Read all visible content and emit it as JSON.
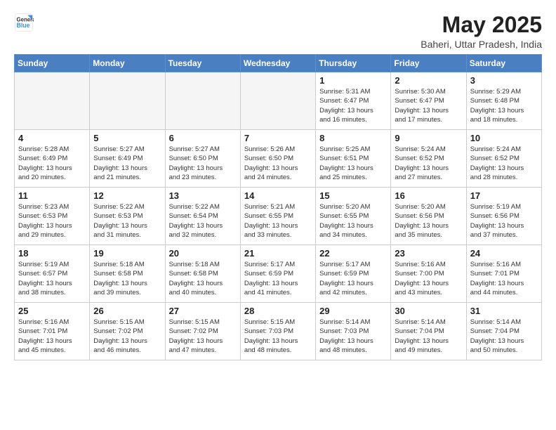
{
  "logo": {
    "line1": "General",
    "line2": "Blue"
  },
  "title": "May 2025",
  "location": "Baheri, Uttar Pradesh, India",
  "days_of_week": [
    "Sunday",
    "Monday",
    "Tuesday",
    "Wednesday",
    "Thursday",
    "Friday",
    "Saturday"
  ],
  "weeks": [
    [
      {
        "day": "",
        "info": ""
      },
      {
        "day": "",
        "info": ""
      },
      {
        "day": "",
        "info": ""
      },
      {
        "day": "",
        "info": ""
      },
      {
        "day": "1",
        "info": "Sunrise: 5:31 AM\nSunset: 6:47 PM\nDaylight: 13 hours\nand 16 minutes."
      },
      {
        "day": "2",
        "info": "Sunrise: 5:30 AM\nSunset: 6:47 PM\nDaylight: 13 hours\nand 17 minutes."
      },
      {
        "day": "3",
        "info": "Sunrise: 5:29 AM\nSunset: 6:48 PM\nDaylight: 13 hours\nand 18 minutes."
      }
    ],
    [
      {
        "day": "4",
        "info": "Sunrise: 5:28 AM\nSunset: 6:49 PM\nDaylight: 13 hours\nand 20 minutes."
      },
      {
        "day": "5",
        "info": "Sunrise: 5:27 AM\nSunset: 6:49 PM\nDaylight: 13 hours\nand 21 minutes."
      },
      {
        "day": "6",
        "info": "Sunrise: 5:27 AM\nSunset: 6:50 PM\nDaylight: 13 hours\nand 23 minutes."
      },
      {
        "day": "7",
        "info": "Sunrise: 5:26 AM\nSunset: 6:50 PM\nDaylight: 13 hours\nand 24 minutes."
      },
      {
        "day": "8",
        "info": "Sunrise: 5:25 AM\nSunset: 6:51 PM\nDaylight: 13 hours\nand 25 minutes."
      },
      {
        "day": "9",
        "info": "Sunrise: 5:24 AM\nSunset: 6:52 PM\nDaylight: 13 hours\nand 27 minutes."
      },
      {
        "day": "10",
        "info": "Sunrise: 5:24 AM\nSunset: 6:52 PM\nDaylight: 13 hours\nand 28 minutes."
      }
    ],
    [
      {
        "day": "11",
        "info": "Sunrise: 5:23 AM\nSunset: 6:53 PM\nDaylight: 13 hours\nand 29 minutes."
      },
      {
        "day": "12",
        "info": "Sunrise: 5:22 AM\nSunset: 6:53 PM\nDaylight: 13 hours\nand 31 minutes."
      },
      {
        "day": "13",
        "info": "Sunrise: 5:22 AM\nSunset: 6:54 PM\nDaylight: 13 hours\nand 32 minutes."
      },
      {
        "day": "14",
        "info": "Sunrise: 5:21 AM\nSunset: 6:55 PM\nDaylight: 13 hours\nand 33 minutes."
      },
      {
        "day": "15",
        "info": "Sunrise: 5:20 AM\nSunset: 6:55 PM\nDaylight: 13 hours\nand 34 minutes."
      },
      {
        "day": "16",
        "info": "Sunrise: 5:20 AM\nSunset: 6:56 PM\nDaylight: 13 hours\nand 35 minutes."
      },
      {
        "day": "17",
        "info": "Sunrise: 5:19 AM\nSunset: 6:56 PM\nDaylight: 13 hours\nand 37 minutes."
      }
    ],
    [
      {
        "day": "18",
        "info": "Sunrise: 5:19 AM\nSunset: 6:57 PM\nDaylight: 13 hours\nand 38 minutes."
      },
      {
        "day": "19",
        "info": "Sunrise: 5:18 AM\nSunset: 6:58 PM\nDaylight: 13 hours\nand 39 minutes."
      },
      {
        "day": "20",
        "info": "Sunrise: 5:18 AM\nSunset: 6:58 PM\nDaylight: 13 hours\nand 40 minutes."
      },
      {
        "day": "21",
        "info": "Sunrise: 5:17 AM\nSunset: 6:59 PM\nDaylight: 13 hours\nand 41 minutes."
      },
      {
        "day": "22",
        "info": "Sunrise: 5:17 AM\nSunset: 6:59 PM\nDaylight: 13 hours\nand 42 minutes."
      },
      {
        "day": "23",
        "info": "Sunrise: 5:16 AM\nSunset: 7:00 PM\nDaylight: 13 hours\nand 43 minutes."
      },
      {
        "day": "24",
        "info": "Sunrise: 5:16 AM\nSunset: 7:01 PM\nDaylight: 13 hours\nand 44 minutes."
      }
    ],
    [
      {
        "day": "25",
        "info": "Sunrise: 5:16 AM\nSunset: 7:01 PM\nDaylight: 13 hours\nand 45 minutes."
      },
      {
        "day": "26",
        "info": "Sunrise: 5:15 AM\nSunset: 7:02 PM\nDaylight: 13 hours\nand 46 minutes."
      },
      {
        "day": "27",
        "info": "Sunrise: 5:15 AM\nSunset: 7:02 PM\nDaylight: 13 hours\nand 47 minutes."
      },
      {
        "day": "28",
        "info": "Sunrise: 5:15 AM\nSunset: 7:03 PM\nDaylight: 13 hours\nand 48 minutes."
      },
      {
        "day": "29",
        "info": "Sunrise: 5:14 AM\nSunset: 7:03 PM\nDaylight: 13 hours\nand 48 minutes."
      },
      {
        "day": "30",
        "info": "Sunrise: 5:14 AM\nSunset: 7:04 PM\nDaylight: 13 hours\nand 49 minutes."
      },
      {
        "day": "31",
        "info": "Sunrise: 5:14 AM\nSunset: 7:04 PM\nDaylight: 13 hours\nand 50 minutes."
      }
    ]
  ]
}
